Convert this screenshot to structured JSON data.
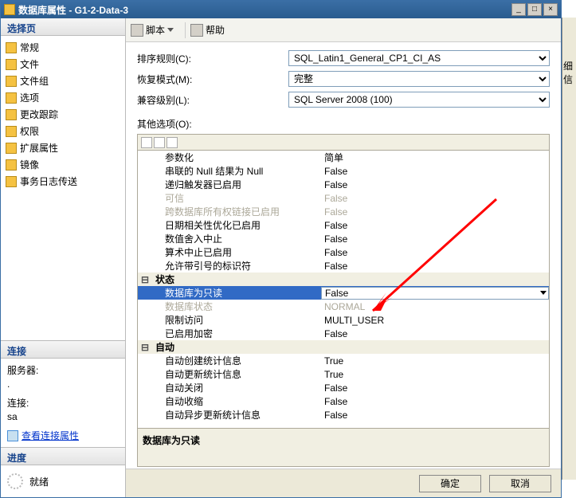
{
  "window": {
    "title": "数据库属性 - G1-2-Data-3"
  },
  "left": {
    "select_header": "选择页",
    "nav": [
      {
        "label": "常规"
      },
      {
        "label": "文件"
      },
      {
        "label": "文件组"
      },
      {
        "label": "选项"
      },
      {
        "label": "更改跟踪"
      },
      {
        "label": "权限"
      },
      {
        "label": "扩展属性"
      },
      {
        "label": "镜像"
      },
      {
        "label": "事务日志传送"
      }
    ],
    "connection": {
      "header": "连接",
      "server_label": "服务器:",
      "server_value": ".",
      "conn_label": "连接:",
      "conn_value": "sa",
      "view_link": "查看连接属性"
    },
    "progress": {
      "header": "进度",
      "status": "就绪"
    }
  },
  "toolbar": {
    "script": "脚本",
    "help": "帮助"
  },
  "form": {
    "collation": {
      "label": "排序规则(C):",
      "value": "SQL_Latin1_General_CP1_CI_AS"
    },
    "recovery": {
      "label": "恢复模式(M):",
      "value": "完整"
    },
    "compat": {
      "label": "兼容级别(L):",
      "value": "SQL Server 2008 (100)"
    },
    "other": "其他选项(O):"
  },
  "grid": {
    "rows": [
      {
        "k": "参数化",
        "v": "简单"
      },
      {
        "k": "串联的 Null 结果为 Null",
        "v": "False"
      },
      {
        "k": "递归触发器已启用",
        "v": "False"
      },
      {
        "k": "可信",
        "v": "False",
        "disabled": true
      },
      {
        "k": "跨数据库所有权链接已启用",
        "v": "False",
        "disabled": true
      },
      {
        "k": "日期相关性优化已启用",
        "v": "False"
      },
      {
        "k": "数值舍入中止",
        "v": "False"
      },
      {
        "k": "算术中止已启用",
        "v": "False"
      },
      {
        "k": "允许带引号的标识符",
        "v": "False"
      }
    ],
    "cat_state": "状态",
    "state_rows": [
      {
        "k": "数据库为只读",
        "v": "False",
        "selected": true
      },
      {
        "k": "数据库状态",
        "v": "NORMAL",
        "disabled": true
      },
      {
        "k": "限制访问",
        "v": "MULTI_USER"
      },
      {
        "k": "已启用加密",
        "v": "False"
      }
    ],
    "cat_auto": "自动",
    "auto_rows": [
      {
        "k": "自动创建统计信息",
        "v": "True"
      },
      {
        "k": "自动更新统计信息",
        "v": "True"
      },
      {
        "k": "自动关闭",
        "v": "False"
      },
      {
        "k": "自动收缩",
        "v": "False"
      },
      {
        "k": "自动异步更新统计信息",
        "v": "False"
      }
    ],
    "desc": "数据库为只读"
  },
  "buttons": {
    "ok": "确定",
    "cancel": "取消"
  },
  "side": "细信"
}
